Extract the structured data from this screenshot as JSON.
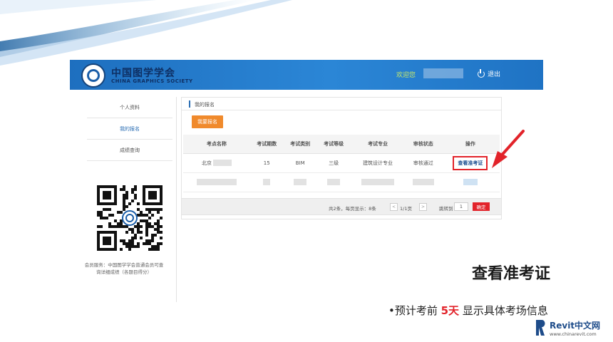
{
  "header": {
    "logo_cn": "中国图学学会",
    "logo_en": "CHINA GRAPHICS SOCIETY",
    "welcome": "欢迎您",
    "logout": "退出"
  },
  "sidebar": {
    "items": [
      {
        "label": "个人资料"
      },
      {
        "label": "我的报名",
        "active": true
      },
      {
        "label": "成绩查询"
      }
    ],
    "qr_caption": "会员服务：中国图学学会普通会员可查询详细成绩（各题目得分）"
  },
  "main": {
    "breadcrumb": "我的报名",
    "enroll_button": "我要报名",
    "table": {
      "columns": [
        "考点名称",
        "考试期数",
        "考试类别",
        "考试等级",
        "考试专业",
        "审核状态",
        "操作"
      ],
      "row1": {
        "site": "北京",
        "period": "15",
        "category": "BIM",
        "level": "三级",
        "major": "建筑设计专业",
        "status": "审核通过",
        "action": "查看准考证"
      }
    },
    "pager": {
      "info": "共2条，每页显示：8条",
      "prev": "<",
      "page": "1/1页",
      "next": ">",
      "goto": "跳转到",
      "page_input": "1",
      "confirm": "确定"
    }
  },
  "slide": {
    "title": "查看准考证",
    "note_prefix": "•预计考前 ",
    "note_highlight": "5天",
    "note_suffix": " 显示具体考场信息"
  },
  "watermark": {
    "title": "Revit中文网",
    "url": "www.chinarevit.com"
  },
  "colors": {
    "header_blue": "#2b86d6",
    "accent_orange": "#f08a2c",
    "alert_red": "#e2232a",
    "link_blue": "#1d4f91"
  }
}
